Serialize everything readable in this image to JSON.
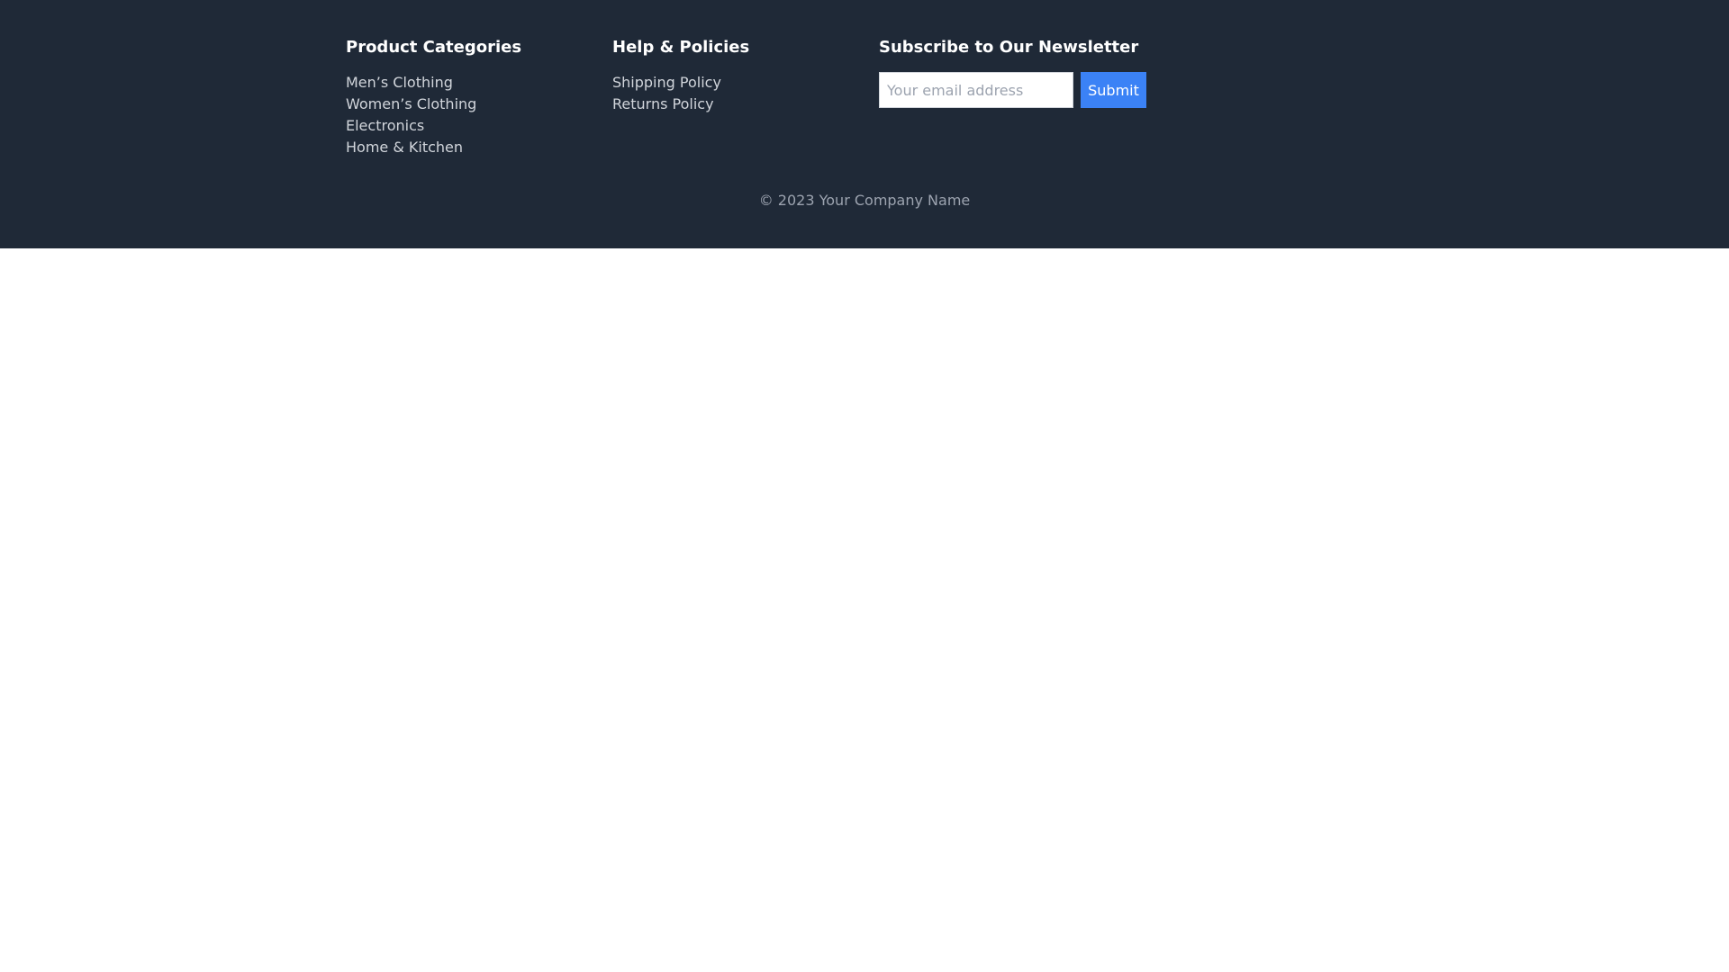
{
  "footer": {
    "categories": {
      "heading": "Product Categories",
      "links": [
        "Men’s Clothing",
        "Women’s Clothing",
        "Electronics",
        "Home & Kitchen"
      ]
    },
    "help": {
      "heading": "Help & Policies",
      "links": [
        "Shipping Policy",
        "Returns Policy"
      ]
    },
    "newsletter": {
      "heading": "Subscribe to Our Newsletter",
      "email_placeholder": "Your email address",
      "email_value": "",
      "submit_label": "Submit"
    },
    "copyright": "© 2023 Your Company Name"
  },
  "colors": {
    "footer_background": "#1f2937",
    "heading_text": "#ffffff",
    "link_text": "#d1d5db",
    "muted_text": "#9ca3af",
    "accent_button": "#3b82f6",
    "page_background": "#ffffff"
  }
}
